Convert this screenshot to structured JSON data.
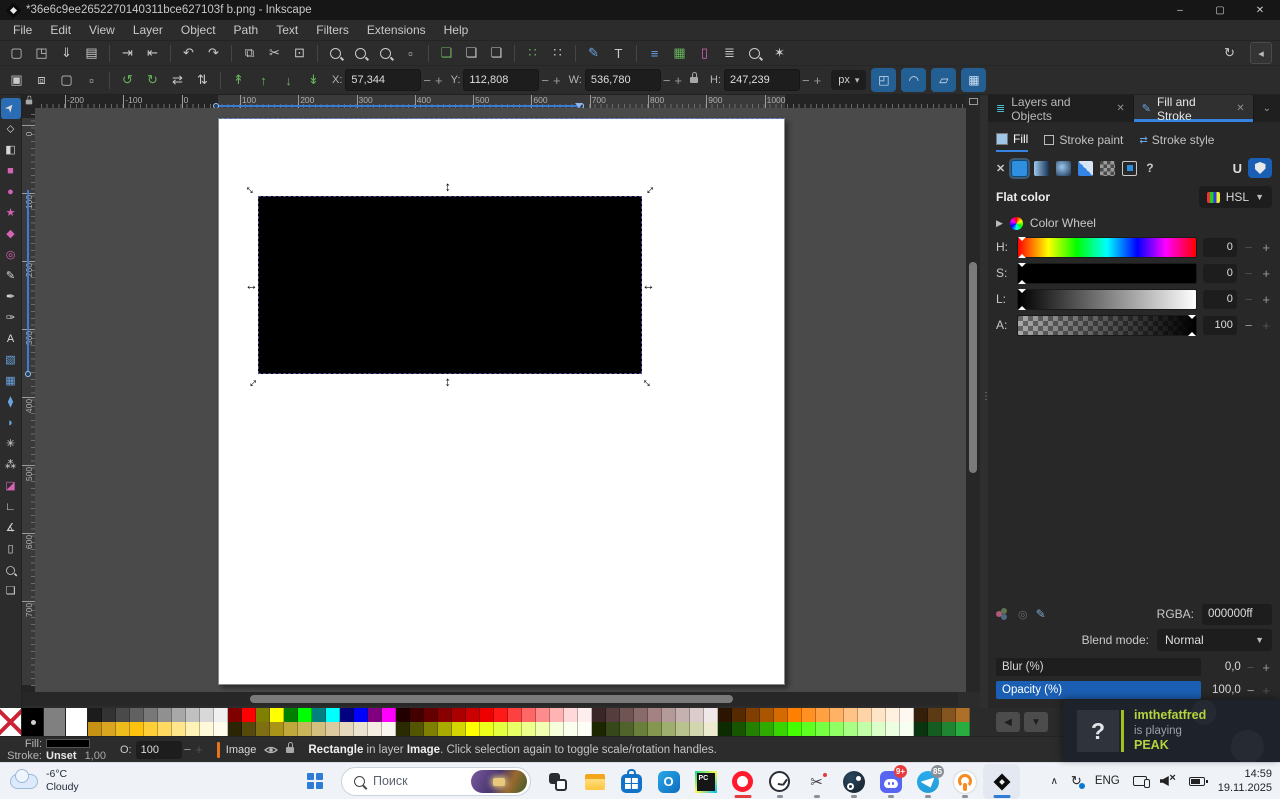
{
  "window": {
    "title": "*36e6c9ee2652270140311bce627103f b.png - Inkscape",
    "menus": [
      "File",
      "Edit",
      "View",
      "Layer",
      "Object",
      "Path",
      "Text",
      "Filters",
      "Extensions",
      "Help"
    ],
    "controls": {
      "minimize": "–",
      "maximize": "▢",
      "close": "✕"
    }
  },
  "cmdbar": {
    "groups": [
      [
        {
          "n": "new-document",
          "g": "▢"
        },
        {
          "n": "open-document",
          "g": "◳"
        },
        {
          "n": "save-document",
          "g": "⇓"
        },
        {
          "n": "print",
          "g": "▤"
        }
      ],
      [
        {
          "n": "import",
          "g": "⇥"
        },
        {
          "n": "export",
          "g": "⇤"
        }
      ],
      [
        {
          "n": "undo",
          "g": "↶"
        },
        {
          "n": "redo",
          "g": "↷"
        }
      ],
      [
        {
          "n": "copy",
          "g": "⧉"
        },
        {
          "n": "cut",
          "g": "✂"
        },
        {
          "n": "paste",
          "g": "⊡"
        }
      ],
      [
        {
          "n": "zoom-selection",
          "t": "mag"
        },
        {
          "n": "zoom-drawing",
          "t": "mag"
        },
        {
          "n": "zoom-page",
          "t": "mag"
        },
        {
          "n": "zoom-region",
          "g": "▫"
        }
      ],
      [
        {
          "n": "duplicate",
          "g": "❏",
          "c": "green"
        },
        {
          "n": "create-clone",
          "g": "❏"
        },
        {
          "n": "unlink-clone",
          "g": "❏"
        }
      ],
      [
        {
          "n": "group",
          "g": "∷",
          "c": "green"
        },
        {
          "n": "ungroup",
          "g": "∷"
        }
      ],
      [
        {
          "n": "fill-stroke-dialog",
          "g": "✎",
          "c": "blue"
        },
        {
          "n": "text-dialog",
          "g": "T"
        }
      ],
      [
        {
          "n": "align-dialog",
          "g": "≡",
          "c": "blue"
        },
        {
          "n": "swatches-dialog",
          "g": "▦",
          "c": "green"
        },
        {
          "n": "document-properties",
          "g": "▯",
          "c": "pink"
        },
        {
          "n": "layers-dialog",
          "g": "≣"
        },
        {
          "n": "xml-editor",
          "t": "mag"
        },
        {
          "n": "preferences",
          "g": "✶"
        }
      ]
    ],
    "right": [
      {
        "n": "rotate-view",
        "g": "↻"
      },
      {
        "n": "collapse-toolbar",
        "g": "◂"
      }
    ]
  },
  "toolctrl": {
    "icons": [
      {
        "n": "select-all",
        "g": "▣"
      },
      {
        "n": "select-all-layers",
        "g": "⧈"
      },
      {
        "n": "deselect",
        "g": "▢"
      },
      {
        "n": "toggle-bbox",
        "g": "▫"
      },
      {
        "n": "rotate-ccw",
        "g": "↺",
        "c": "green"
      },
      {
        "n": "rotate-cw",
        "g": "↻",
        "c": "green"
      },
      {
        "n": "flip-horizontal",
        "g": "⇄"
      },
      {
        "n": "flip-vertical",
        "g": "⇅"
      },
      {
        "n": "raise-to-top",
        "g": "↟",
        "c": "green"
      },
      {
        "n": "raise",
        "g": "↑",
        "c": "green"
      },
      {
        "n": "lower",
        "g": "↓",
        "c": "green"
      },
      {
        "n": "lower-to-bottom",
        "g": "↡",
        "c": "green"
      }
    ],
    "fields": [
      {
        "k": "x",
        "label": "X:",
        "value": "57,344"
      },
      {
        "k": "y",
        "label": "Y:",
        "value": "112,808"
      },
      {
        "k": "w",
        "label": "W:",
        "value": "536,780"
      }
    ],
    "h_field": {
      "k": "h",
      "label": "H:",
      "value": "247,239"
    },
    "unit": "px",
    "toggles": [
      {
        "n": "scale-stroke",
        "g": "◰"
      },
      {
        "n": "scale-corners",
        "g": "◠"
      },
      {
        "n": "scale-gradients",
        "g": "▱"
      },
      {
        "n": "scale-patterns",
        "g": "▦"
      }
    ]
  },
  "toolbox": [
    {
      "n": "selector",
      "g": "➤",
      "rot": true,
      "active": true
    },
    {
      "n": "node-editor",
      "g": "⬦"
    },
    {
      "n": "shape-builder",
      "g": "◧"
    },
    {
      "n": "rectangle",
      "g": "■",
      "c": "pink"
    },
    {
      "n": "ellipse",
      "g": "●",
      "c": "pink"
    },
    {
      "n": "star",
      "g": "★",
      "c": "pink"
    },
    {
      "n": "box-3d",
      "g": "◆",
      "c": "pink"
    },
    {
      "n": "spiral",
      "g": "◎",
      "c": "pink"
    },
    {
      "n": "pencil",
      "g": "✎"
    },
    {
      "n": "bezier-pen",
      "g": "✒"
    },
    {
      "n": "calligraphy",
      "g": "✑"
    },
    {
      "n": "text-tool",
      "g": "A"
    },
    {
      "n": "gradient",
      "g": "▧",
      "c": "blue"
    },
    {
      "n": "mesh-gradient",
      "g": "▦",
      "c": "blue"
    },
    {
      "n": "dropper",
      "g": "⧫",
      "c": "blue"
    },
    {
      "n": "paint-bucket",
      "g": "◗",
      "c": "blue"
    },
    {
      "n": "tweak",
      "g": "✳"
    },
    {
      "n": "spray",
      "g": "⁂"
    },
    {
      "n": "eraser",
      "g": "◪",
      "c": "pink"
    },
    {
      "n": "connector",
      "g": "∟"
    },
    {
      "n": "measure",
      "g": "∡"
    },
    {
      "n": "page-tool",
      "g": "▯"
    },
    {
      "n": "zoom-tool",
      "t": "mag"
    },
    {
      "n": "pages",
      "g": "❏"
    }
  ],
  "rulers": {
    "h": [
      "-200",
      "-100",
      "0",
      "100",
      "200",
      "300",
      "400",
      "500",
      "600",
      "700",
      "800",
      "900",
      "1000"
    ],
    "v": [
      "0",
      "100",
      "200",
      "300",
      "400",
      "500",
      "600",
      "700"
    ]
  },
  "dock": {
    "tabs": [
      {
        "label": "Layers and Objects",
        "close": "✕"
      },
      {
        "label": "Fill and Stroke",
        "close": "✕",
        "active": true
      }
    ],
    "chevron": "⌄",
    "subtabs": [
      {
        "label": "Fill",
        "active": true
      },
      {
        "label": "Stroke paint"
      },
      {
        "label": "Stroke style"
      }
    ],
    "no_paint": "✕",
    "unknown_paint": "?",
    "flat_color": "Flat color",
    "mode": "HSL",
    "wheel": "Color Wheel",
    "sliders": [
      {
        "k": "h",
        "label": "H:",
        "value": "0"
      },
      {
        "k": "s",
        "label": "S:",
        "value": "0"
      },
      {
        "k": "l",
        "label": "L:",
        "value": "0"
      },
      {
        "k": "a",
        "label": "A:",
        "value": "100"
      }
    ],
    "rgba_label": "RGBA:",
    "rgba_value": "000000ff",
    "blend_label": "Blend mode:",
    "blend_value": "Normal",
    "blur_label": "Blur (%)",
    "blur_value": "0,0",
    "opacity_label": "Opacity (%)",
    "opacity_value": "100,0"
  },
  "palette": {
    "big": [
      {
        "kind": "none",
        "name": "no-color"
      },
      {
        "kind": "blackdot",
        "color": "#000000"
      },
      {
        "kind": "solid",
        "color": "#808080"
      },
      {
        "kind": "solid",
        "color": "#ffffff"
      }
    ],
    "top": [
      "#1c1c1c",
      "#333333",
      "#4a4a4a",
      "#616161",
      "#787878",
      "#909090",
      "#a8a8a8",
      "#c0c0c0",
      "#d8d8d8",
      "#f0f0f0",
      "#800000",
      "#ff0000",
      "#808000",
      "#ffff00",
      "#008000",
      "#00ff00",
      "#008080",
      "#00ffff",
      "#000080",
      "#0000ff",
      "#800080",
      "#ff00ff",
      "#220000",
      "#440000",
      "#660000",
      "#880000",
      "#aa0000",
      "#cc0000",
      "#ee0000",
      "#ff1a1a",
      "#ff4040",
      "#ff6666",
      "#ff8c8c",
      "#ffb3b3",
      "#ffd9d9",
      "#ffeeee",
      "#3a2626",
      "#553d3d",
      "#705454",
      "#8a6b6b",
      "#a58282",
      "#b59a9a",
      "#c6b1b1",
      "#ddcccc",
      "#f0e8e8",
      "#2b1500",
      "#552a00",
      "#803f00",
      "#aa5500",
      "#d46a00",
      "#ff7f00",
      "#ff9021",
      "#ffa142",
      "#ffb264",
      "#ffc385",
      "#ffd4a6",
      "#ffe5c8",
      "#fff0e0",
      "#fff8f0",
      "#331f0a",
      "#5c3a14",
      "#85551f",
      "#ad7029"
    ],
    "bottom": [
      "#c69214",
      "#daa520",
      "#eebc1d",
      "#ffc20e",
      "#ffce38",
      "#ffda62",
      "#ffe68c",
      "#fff2b6",
      "#fff8da",
      "#fffcee",
      "#2b2506",
      "#554a0c",
      "#806f12",
      "#aa9418",
      "#bfa93a",
      "#c9b45c",
      "#d3bf7e",
      "#ddcaa0",
      "#e5d8bc",
      "#ece2d0",
      "#f3ede2",
      "#f9f6f0",
      "#2a2b00",
      "#545500",
      "#7f8000",
      "#a9aa00",
      "#d4d500",
      "#ffff00",
      "#ecff1a",
      "#e4ff40",
      "#e8ff66",
      "#edff8c",
      "#f2ffb3",
      "#f6ffd9",
      "#faffee",
      "#fdfff6",
      "#1c2600",
      "#36471a",
      "#50632a",
      "#6a7f3a",
      "#84964f",
      "#9eae6f",
      "#b8c28f",
      "#d2d6af",
      "#ecebd0",
      "#0c2b00",
      "#175500",
      "#238000",
      "#2eaa00",
      "#3ad400",
      "#45ff00",
      "#5eff21",
      "#77ff42",
      "#90ff64",
      "#a9ff85",
      "#c2ffa6",
      "#dbffc8",
      "#ecffe0",
      "#f6fff0",
      "#0a3310",
      "#145c20",
      "#1f8530",
      "#29ad40"
    ]
  },
  "statusbar": {
    "fill_label": "Fill:",
    "stroke_label": "Stroke:",
    "stroke_value": "Unset",
    "stroke_width": "1,00",
    "opacity_label": "O:",
    "opacity_value": "100",
    "layer_name": "Image",
    "msg": [
      "Rectangle",
      " in layer ",
      "Image",
      ". Click selection again to toggle scale/rotation handles."
    ]
  },
  "notification": {
    "avatar": "?",
    "user": "imthefatfred",
    "action": "is playing",
    "game": "PEAK"
  },
  "taskbar": {
    "weather_temp": "-6°C",
    "weather_cond": "Cloudy",
    "search_placeholder": "Поиск",
    "apps": [
      {
        "n": "task-view"
      },
      {
        "n": "explorer"
      },
      {
        "n": "store"
      },
      {
        "n": "outlook",
        "txt": "O"
      },
      {
        "n": "pycharm",
        "txt": "PC"
      },
      {
        "n": "opera",
        "ind": "red"
      },
      {
        "n": "clock",
        "ind": "dot"
      },
      {
        "n": "snipping",
        "g": "✂",
        "ind": "dot"
      },
      {
        "n": "steam",
        "ind": "dot"
      },
      {
        "n": "discord",
        "ind": "dot",
        "badge": "9+"
      },
      {
        "n": "telegram",
        "ind": "dot",
        "badge": "85",
        "badge_gray": true
      },
      {
        "n": "openvpn",
        "ind": "dot"
      },
      {
        "n": "inkscape",
        "ind": "blue",
        "active": true
      }
    ],
    "tray_lang": "ENG",
    "time": "14:59",
    "date": "19.11.2025"
  },
  "colors": {
    "accent_blue": "#3584e4",
    "opacity_fill": "#1a5fb4",
    "steam_green": "#b5d33e",
    "layer_marker": "#e8731a",
    "selection_fill": "#000000",
    "rgba": "000000ff"
  }
}
